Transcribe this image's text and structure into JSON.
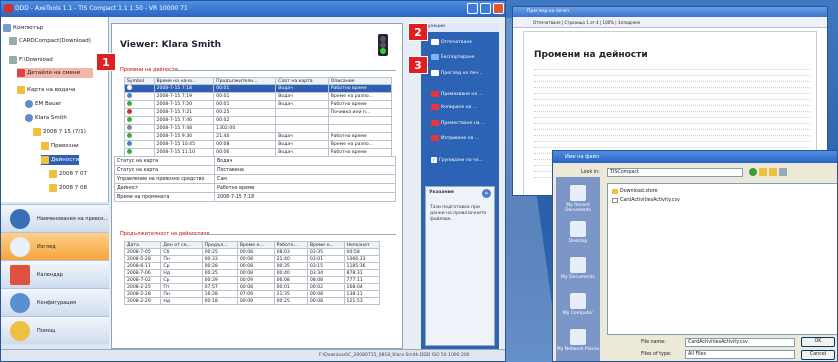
{
  "main_window": {
    "title": "DDD - AxeTools 1.1 - TIS Compact 1.1 1.50 - VR 10000 71",
    "status_bar": "F:\\Download\\C_20080715_0818_Klara Smith.DDD  ISO 50  1000  200"
  },
  "tree": {
    "items": [
      {
        "label": "Компютър",
        "icon": "computer-icon"
      },
      {
        "label": "CARDCompact(Download)",
        "icon": "disk-icon"
      },
      {
        "label": "F:\\Download",
        "icon": "folder-icon"
      },
      {
        "label": "Детайли на смени",
        "icon": "card-icon"
      },
      {
        "label": "Карта на водача",
        "icon": "folder-icon"
      },
      {
        "label": "EM Bauer",
        "icon": "user-icon"
      },
      {
        "label": "Klara Smith",
        "icon": "user-icon"
      },
      {
        "label": "2008 7 15 (7/1)",
        "icon": "folder-icon"
      },
      {
        "label": "Превозни",
        "icon": "folder-icon"
      },
      {
        "label": "Дейности",
        "icon": "folder-icon"
      },
      {
        "label": "2008 7 07",
        "icon": "folder-icon"
      },
      {
        "label": "2008 7 08",
        "icon": "folder-icon"
      }
    ]
  },
  "nav": {
    "items": [
      {
        "label": "Наименования на превоз...",
        "icon": "clock-icon"
      },
      {
        "label": "Изглед",
        "icon": "view-icon"
      },
      {
        "label": "Календар",
        "icon": "calendar-icon"
      },
      {
        "label": "Конфигурация",
        "icon": "gear-icon"
      },
      {
        "label": "Помощ",
        "icon": "help-icon"
      }
    ],
    "active_index": 1
  },
  "report": {
    "viewer_title": "Viewer: Klara Smith",
    "section1_title": "Промени на дейности",
    "table1_headers": [
      "Symbol",
      "Време на нача...",
      "Продължителн...",
      "Слот на карта",
      "Описание"
    ],
    "table1_rows": [
      [
        "2008-7-15 7:18",
        "00:01",
        "Водач",
        "Работно време"
      ],
      [
        "2008-7-15 7:19",
        "00:01",
        "Водач",
        "Време на разпо..."
      ],
      [
        "2008-7-15 7:20",
        "00:01",
        "Водач",
        "Работно време"
      ],
      [
        "2008-7-15 7:21",
        "00:25",
        "",
        "Почивка или п..."
      ],
      [
        "2008-7-15 7:46",
        "00:02",
        "",
        ""
      ],
      [
        "2008-7-15 7:48",
        "1302:00",
        "",
        ""
      ],
      [
        "2008-7-15 9:30",
        "21:40",
        "Водач",
        "Работно време"
      ],
      [
        "2008-7-15 10:45",
        "00:08",
        "Водач",
        "Време на разпо..."
      ],
      [
        "2008-7-15 11:10",
        "00:06",
        "Водач",
        "Работно време"
      ]
    ],
    "details": [
      {
        "label": "Статус на карта",
        "value": "Водач"
      },
      {
        "label": "Статус на карта",
        "value": "Поставена"
      },
      {
        "label": "Управление на превозно средство",
        "value": "Сам"
      },
      {
        "label": "Дейност",
        "value": "Работно време"
      },
      {
        "label": "Време на промяната",
        "value": "2008-7-15 7:18"
      }
    ],
    "section2_title": "Продължителност на дейностите",
    "table2_headers": [
      "Дата",
      "Ден от се...",
      "Продъл...",
      "Време н...",
      "Работн...",
      "Време н...",
      "Непознат"
    ],
    "table2_rows": [
      [
        "2008-7-05",
        "Сб",
        "00:25",
        "00:08",
        "08:03",
        "03:35",
        "00:58"
      ],
      [
        "2008-5-28",
        "Пн",
        "00:33",
        "00:08",
        "21:40",
        "03:01",
        "1066:33"
      ],
      [
        "2008-6-11",
        "Ср",
        "00:28",
        "00:08",
        "00:35",
        "03:15",
        "1185:36"
      ],
      [
        "2008-7-06",
        "Нд",
        "00:25",
        "00:08",
        "00:40",
        "03:34",
        "878:31"
      ],
      [
        "2008-7-02",
        "Ср",
        "00:29",
        "00:09",
        "06:08",
        "08:08",
        "777:11"
      ],
      [
        "2008-2-25",
        "Пт",
        "07:57",
        "00:08",
        "00:01",
        "00:02",
        "168:04"
      ],
      [
        "2008-2-28",
        "Пн",
        "16:28",
        "07:09",
        "21:35",
        "00:08",
        "138:11"
      ],
      [
        "2008-2-29",
        "Нд",
        "00:18",
        "00:09",
        "00:25",
        "00:08",
        "121:53"
      ]
    ]
  },
  "actions": {
    "header": "Функции",
    "items": [
      {
        "label": "Отпечатване",
        "icon": "print-icon"
      },
      {
        "label": "Експортиране",
        "icon": "export-icon"
      },
      {
        "label": "Преглед на печ...",
        "icon": "preview-icon"
      },
      {
        "label": "Премахване на ...",
        "icon": "remove-icon"
      },
      {
        "label": "Копиране на ...",
        "icon": "copy-icon"
      },
      {
        "label": "Преместване на ...",
        "icon": "move-icon"
      },
      {
        "label": "Изтриване на ...",
        "icon": "delete-icon"
      }
    ],
    "checkbox_label": "Групиране по чл...",
    "checkbox_checked": true,
    "info_title": "Указания",
    "info_text": "Тази подготовка при данни на превозочните файлове."
  },
  "callouts": [
    "1",
    "2",
    "3"
  ],
  "print_preview": {
    "title": "Преглед на печат",
    "toolbar": "Отпечатване  |  Страница  1  от 4  |  100%  |  Затваряне",
    "page_title": "Промени на дейности"
  },
  "save_dialog": {
    "title": "Имe на файл",
    "look_in_label": "Look in:",
    "look_in_value": "TISCompact",
    "places": [
      "My Recent Documents",
      "Desktop",
      "My Documents",
      "My Computer",
      "My Network Places"
    ],
    "files": [
      {
        "name": "Download.store",
        "type": "folder"
      },
      {
        "name": "CardActivitiesActivity.csv",
        "type": "file"
      }
    ],
    "file_name_label": "File name:",
    "file_name_value": "CardActivitiesActivity.csv",
    "file_type_label": "Files of type:",
    "file_type_value": "All Files",
    "ok_label": "OK",
    "cancel_label": "Cancel"
  }
}
